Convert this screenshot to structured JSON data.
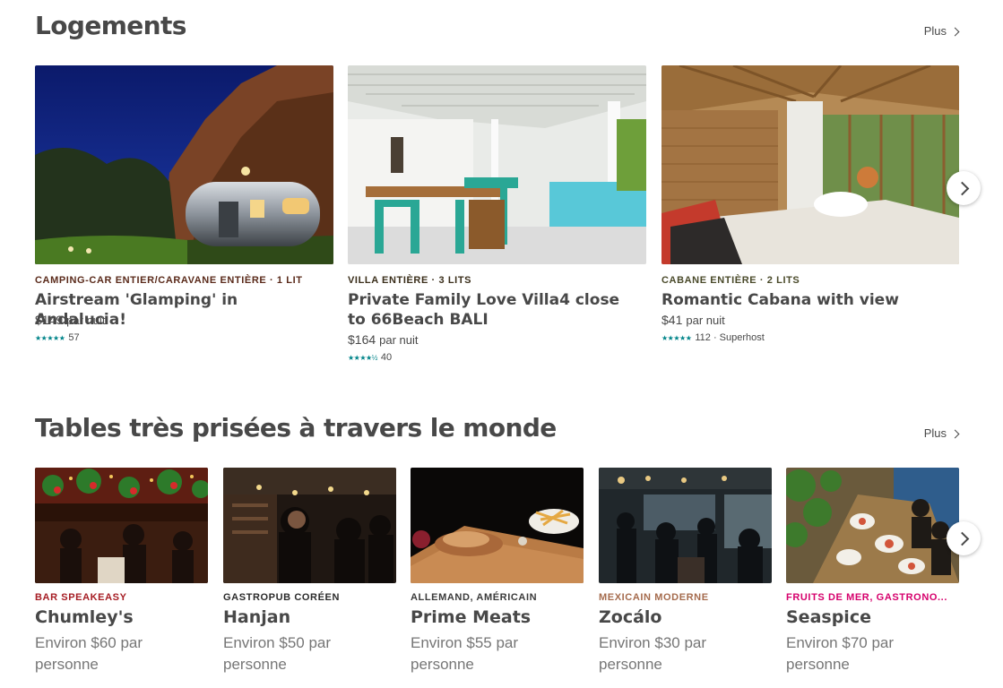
{
  "sections": {
    "homes": {
      "title": "Logements",
      "more_label": "Plus",
      "listings": [
        {
          "kicker": "CAMPING-CAR ENTIER/CARAVANE ENTIÈRE · 1 LIT",
          "kicker_color": "#5a2a1a",
          "title": "Airstream 'Glamping' in Andalucia!",
          "price": "$149",
          "price_unit": "par nuit",
          "stars": "★★★★★",
          "reviews": "57",
          "photo_icon": "airstream-photo"
        },
        {
          "kicker": "VILLA ENTIÈRE · 3 LITS",
          "kicker_color": "#3a2e1a",
          "title": "Private Family Love Villa4 close to 66Beach BALI",
          "price": "$164",
          "price_unit": "par nuit",
          "stars": "★★★★½",
          "reviews": "40",
          "photo_icon": "villa-photo"
        },
        {
          "kicker": "CABANE ENTIÈRE · 2 LITS",
          "kicker_color": "#4a4a2a",
          "title": "Romantic Cabana with view",
          "price": "$41",
          "price_unit": "par nuit",
          "stars": "★★★★★",
          "reviews": "112 · Superhost",
          "photo_icon": "cabana-photo"
        }
      ]
    },
    "restaurants": {
      "title": "Tables très prisées à travers le monde",
      "more_label": "Plus",
      "items": [
        {
          "kicker": "BAR SPEAKEASY",
          "kicker_color": "#a61d24",
          "name": "Chumley's",
          "price": "Environ $60 par personne",
          "photo_icon": "bar-photo"
        },
        {
          "kicker": "GASTROPUB CORÉEN",
          "kicker_color": "#2b2b2b",
          "name": "Hanjan",
          "price": "Environ $50 par personne",
          "photo_icon": "gastropub-photo"
        },
        {
          "kicker": "ALLEMAND, AMÉRICAIN",
          "kicker_color": "#3a3a3a",
          "name": "Prime Meats",
          "price": "Environ $55 par personne",
          "photo_icon": "meal-photo"
        },
        {
          "kicker": "MEXICAIN MODERNE",
          "kicker_color": "#a56b4d",
          "name": "Zocálo",
          "price": "Environ $30 par personne",
          "photo_icon": "dining-room-photo"
        },
        {
          "kicker": "FRUITS DE MER, GASTRONO...",
          "kicker_color": "#d6006c",
          "name": "Seaspice",
          "price": "Environ $70 par personne",
          "photo_icon": "seafood-table-photo"
        }
      ]
    }
  },
  "controls": {
    "next_icon": "chevron-right-icon",
    "rating_color": "#008489"
  }
}
